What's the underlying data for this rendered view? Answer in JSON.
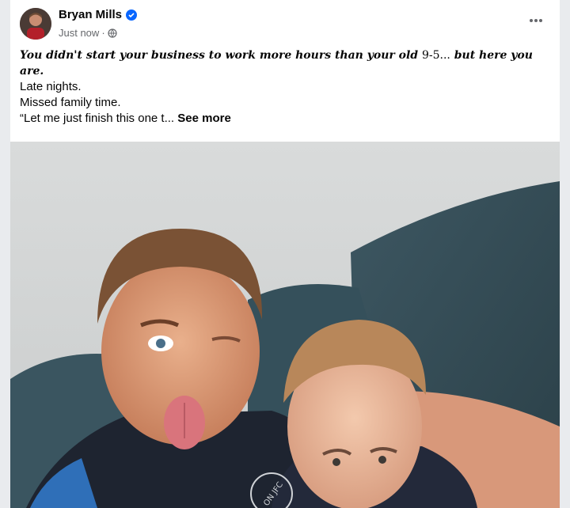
{
  "post": {
    "author": "Bryan Mills",
    "timestamp": "Just now",
    "separator": "·",
    "headline": {
      "part1": "You didn't start your business to work more hours than your old ",
      "part2": "9-5...",
      "part3": " but here you are."
    },
    "lines": [
      "Late nights.",
      "Missed family time.",
      "“Let me just finish this one t..."
    ],
    "see_more": "See more",
    "icons": {
      "verified": "verified-badge-icon",
      "privacy": "globe-icon",
      "more": "more-options-icon"
    }
  },
  "photo": {
    "shirt_text": "ON JFC"
  },
  "colors": {
    "accent": "#0866ff",
    "secondary_text": "#65676b"
  }
}
